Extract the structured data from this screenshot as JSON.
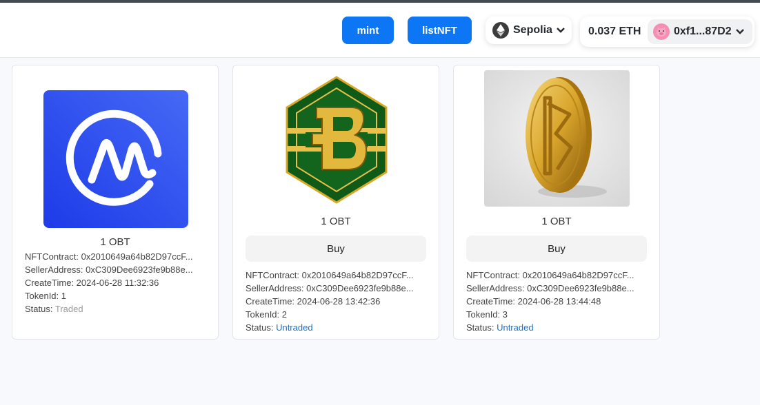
{
  "header": {
    "mint_label": "mint",
    "listnft_label": "listNFT",
    "network": {
      "name": "Sepolia",
      "icon": "ethereum-icon"
    },
    "account": {
      "balance": "0.037 ETH",
      "address": "0xf1...87D2",
      "avatar_icon": "pig-avatar-icon"
    }
  },
  "cards": [
    {
      "image_icon": "coinmarketcap-logo",
      "price": "1 OBT",
      "buy_label": "",
      "fields": {
        "contract": "NFTContract:  0x2010649a64b82D97ccF...",
        "seller": "SellerAddress:  0xC309Dee6923fe9b88e...",
        "created": "CreateTime: 2024-06-28 11:32:36",
        "token": "TokenId:  1",
        "status_label": "Status:  ",
        "status_value": "Traded"
      }
    },
    {
      "image_icon": "green-hexagon-b-coin",
      "price": "1 OBT",
      "buy_label": "Buy",
      "fields": {
        "contract": "NFTContract:  0x2010649a64b82D97ccF...",
        "seller": "SellerAddress:  0xC309Dee6923fe9b88e...",
        "created": "CreateTime: 2024-06-28 13:42:36",
        "token": "TokenId:  2",
        "status_label": "Status:  ",
        "status_value": "Untraded"
      }
    },
    {
      "image_icon": "gold-coin-3d",
      "price": "1 OBT",
      "buy_label": "Buy",
      "fields": {
        "contract": "NFTContract:  0x2010649a64b82D97ccF...",
        "seller": "SellerAddress:  0xC309Dee6923fe9b88e...",
        "created": "CreateTime: 2024-06-28 13:44:48",
        "token": "TokenId:  3",
        "status_label": "Status:  ",
        "status_value": "Untraded"
      }
    }
  ],
  "colors": {
    "accent": "#0d76f5",
    "traded": "#999999",
    "untraded": "#1a73c8"
  }
}
